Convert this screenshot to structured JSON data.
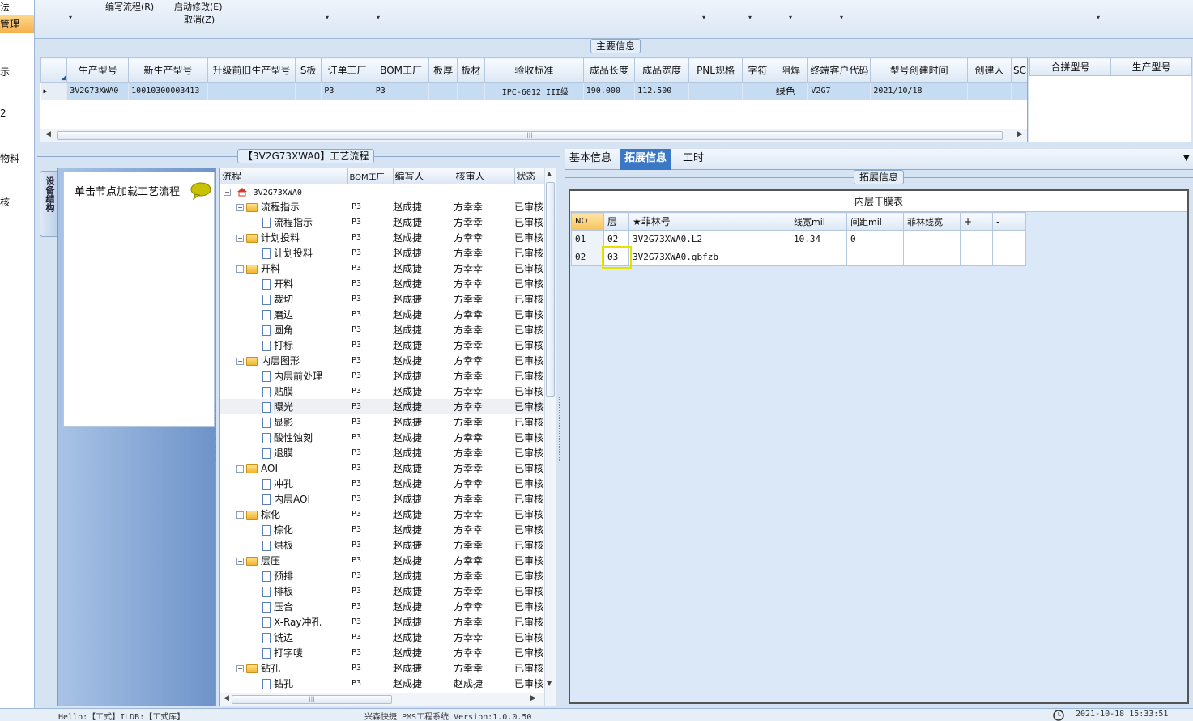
{
  "left_nav": {
    "items": [
      "法",
      "管理",
      "示",
      "2",
      "物料",
      "核"
    ]
  },
  "toolbar": {
    "edit_flow": "编写流程(R)",
    "start_modify": "启动修改(E)",
    "cancel": "取消(Z)",
    "dropdown_glyph": "▾"
  },
  "main_info": {
    "legend": "主要信息",
    "columns": [
      "生产型号",
      "新生产型号",
      "升级前旧生产型号",
      "S板",
      "订单工厂",
      "BOM工厂",
      "板厚",
      "板材",
      "验收标准",
      "成品长度",
      "成品宽度",
      "PNL规格",
      "字符",
      "阻焊",
      "终端客户代码",
      "型号创建时间",
      "创建人",
      "SC"
    ],
    "row": [
      "3V2G73XWA0",
      "10010300003413",
      "",
      "",
      "P3",
      "P3",
      "",
      "",
      "IPC-6012 III级",
      "190.000",
      "112.500",
      "",
      "",
      "绿色",
      "V2G7",
      "2021/10/18",
      "",
      ""
    ],
    "row_indicator": "▶",
    "scroll_left": "◀",
    "scroll_right": "▶",
    "scroll_grip": "|||"
  },
  "merge_grid": {
    "columns": [
      "合拼型号",
      "生产型号"
    ]
  },
  "flow_panel": {
    "legend": "【3V2G73XWA0】工艺流程",
    "vtab": "设备结构",
    "hint": "单击节点加载工艺流程",
    "columns": [
      "流程",
      "BOM工厂",
      "编写人",
      "核审人",
      "状态"
    ],
    "root": "3V2G73XWA0",
    "scroll_up": "▲",
    "scroll_down": "▼",
    "scroll_left": "◀",
    "scroll_right": "▶",
    "scroll_grip": "|||",
    "rows": [
      {
        "name": "流程指示",
        "folder": true,
        "bom": "P3",
        "writer": "赵成捷",
        "reviewer": "方幸幸",
        "status": "已审核"
      },
      {
        "name": "流程指示",
        "folder": false,
        "bom": "P3",
        "writer": "赵成捷",
        "reviewer": "方幸幸",
        "status": "已审核"
      },
      {
        "name": "计划投料",
        "folder": true,
        "bom": "P3",
        "writer": "赵成捷",
        "reviewer": "方幸幸",
        "status": "已审核"
      },
      {
        "name": "计划投料",
        "folder": false,
        "bom": "P3",
        "writer": "赵成捷",
        "reviewer": "方幸幸",
        "status": "已审核"
      },
      {
        "name": "开料",
        "folder": true,
        "bom": "P3",
        "writer": "赵成捷",
        "reviewer": "方幸幸",
        "status": "已审核"
      },
      {
        "name": "开料",
        "folder": false,
        "bom": "P3",
        "writer": "赵成捷",
        "reviewer": "方幸幸",
        "status": "已审核"
      },
      {
        "name": "裁切",
        "folder": false,
        "bom": "P3",
        "writer": "赵成捷",
        "reviewer": "方幸幸",
        "status": "已审核"
      },
      {
        "name": "磨边",
        "folder": false,
        "bom": "P3",
        "writer": "赵成捷",
        "reviewer": "方幸幸",
        "status": "已审核"
      },
      {
        "name": "圆角",
        "folder": false,
        "bom": "P3",
        "writer": "赵成捷",
        "reviewer": "方幸幸",
        "status": "已审核"
      },
      {
        "name": "打标",
        "folder": false,
        "bom": "P3",
        "writer": "赵成捷",
        "reviewer": "方幸幸",
        "status": "已审核"
      },
      {
        "name": "内层图形",
        "folder": true,
        "bom": "P3",
        "writer": "赵成捷",
        "reviewer": "方幸幸",
        "status": "已审核"
      },
      {
        "name": "内层前处理",
        "folder": false,
        "bom": "P3",
        "writer": "赵成捷",
        "reviewer": "方幸幸",
        "status": "已审核"
      },
      {
        "name": "贴膜",
        "folder": false,
        "bom": "P3",
        "writer": "赵成捷",
        "reviewer": "方幸幸",
        "status": "已审核"
      },
      {
        "name": "曝光",
        "folder": false,
        "bom": "P3",
        "writer": "赵成捷",
        "reviewer": "方幸幸",
        "status": "已审核",
        "selected": true
      },
      {
        "name": "显影",
        "folder": false,
        "bom": "P3",
        "writer": "赵成捷",
        "reviewer": "方幸幸",
        "status": "已审核"
      },
      {
        "name": "酸性蚀刻",
        "folder": false,
        "bom": "P3",
        "writer": "赵成捷",
        "reviewer": "方幸幸",
        "status": "已审核"
      },
      {
        "name": "退膜",
        "folder": false,
        "bom": "P3",
        "writer": "赵成捷",
        "reviewer": "方幸幸",
        "status": "已审核"
      },
      {
        "name": "AOI",
        "folder": true,
        "bom": "P3",
        "writer": "赵成捷",
        "reviewer": "方幸幸",
        "status": "已审核"
      },
      {
        "name": "冲孔",
        "folder": false,
        "bom": "P3",
        "writer": "赵成捷",
        "reviewer": "方幸幸",
        "status": "已审核"
      },
      {
        "name": "内层AOI",
        "folder": false,
        "bom": "P3",
        "writer": "赵成捷",
        "reviewer": "方幸幸",
        "status": "已审核"
      },
      {
        "name": "棕化",
        "folder": true,
        "bom": "P3",
        "writer": "赵成捷",
        "reviewer": "方幸幸",
        "status": "已审核"
      },
      {
        "name": "棕化",
        "folder": false,
        "bom": "P3",
        "writer": "赵成捷",
        "reviewer": "方幸幸",
        "status": "已审核"
      },
      {
        "name": "烘板",
        "folder": false,
        "bom": "P3",
        "writer": "赵成捷",
        "reviewer": "方幸幸",
        "status": "已审核"
      },
      {
        "name": "层压",
        "folder": true,
        "bom": "P3",
        "writer": "赵成捷",
        "reviewer": "方幸幸",
        "status": "已审核"
      },
      {
        "name": "预排",
        "folder": false,
        "bom": "P3",
        "writer": "赵成捷",
        "reviewer": "方幸幸",
        "status": "已审核"
      },
      {
        "name": "排板",
        "folder": false,
        "bom": "P3",
        "writer": "赵成捷",
        "reviewer": "方幸幸",
        "status": "已审核"
      },
      {
        "name": "压合",
        "folder": false,
        "bom": "P3",
        "writer": "赵成捷",
        "reviewer": "方幸幸",
        "status": "已审核"
      },
      {
        "name": "X-Ray冲孔",
        "folder": false,
        "bom": "P3",
        "writer": "赵成捷",
        "reviewer": "方幸幸",
        "status": "已审核"
      },
      {
        "name": "铣边",
        "folder": false,
        "bom": "P3",
        "writer": "赵成捷",
        "reviewer": "方幸幸",
        "status": "已审核"
      },
      {
        "name": "打字唛",
        "folder": false,
        "bom": "P3",
        "writer": "赵成捷",
        "reviewer": "方幸幸",
        "status": "已审核"
      },
      {
        "name": "钻孔",
        "folder": true,
        "bom": "P3",
        "writer": "赵成捷",
        "reviewer": "方幸幸",
        "status": "已审核"
      },
      {
        "name": "钻孔",
        "folder": false,
        "bom": "P3",
        "writer": "赵成捷",
        "reviewer": "赵成捷",
        "status": "已审核"
      }
    ]
  },
  "right_panel": {
    "tabs": [
      "基本信息",
      "拓展信息",
      "工时"
    ],
    "active_tab": 1,
    "menu_arrow": "▼",
    "legend": "拓展信息",
    "table_title": "内层干膜表",
    "columns": [
      "NO",
      "层",
      "★菲林号",
      "线宽mil",
      "间距mil",
      "菲林线宽",
      "+",
      "-"
    ],
    "rows": [
      [
        "01",
        "02",
        "3V2G73XWA0.L2",
        "10.34",
        "0",
        "",
        "",
        ""
      ],
      [
        "02",
        "03",
        "3V2G73XWA0.gbfzb",
        "",
        "",
        "",
        "",
        ""
      ]
    ]
  },
  "status_bar": {
    "left": "Hello:【工式】ILDB:【工式库】",
    "center": "兴森快捷 PMS工程系统 Version:1.0.0.50",
    "right": "2021-10-18 15:33:51"
  },
  "colors": {
    "accent": "#c6dcf3",
    "tab_active": "#3a78c6",
    "highlight": "#e8e000"
  }
}
